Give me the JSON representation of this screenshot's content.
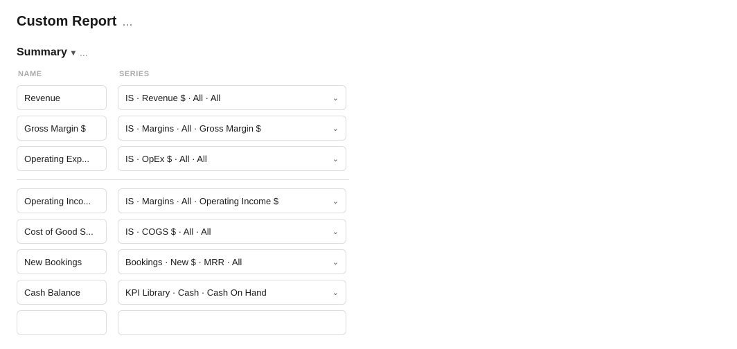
{
  "page": {
    "title": "Custom Report",
    "title_ellipsis": "..."
  },
  "section": {
    "label": "Summary",
    "chevron": "▾",
    "ellipsis": "..."
  },
  "columns": {
    "name": "NAME",
    "series": "SERIES"
  },
  "group1": [
    {
      "name": "Revenue",
      "series": "IS · Revenue $ · All · All"
    },
    {
      "name": "Gross Margin $",
      "series": "IS · Margins · All · Gross Margin $"
    },
    {
      "name": "Operating Exp...",
      "series": "IS · OpEx $ · All · All"
    }
  ],
  "group2": [
    {
      "name": "Operating Inco...",
      "series": "IS · Margins · All · Operating Income $"
    },
    {
      "name": "Cost of Good S...",
      "series": "IS · COGS $ · All · All"
    },
    {
      "name": "New Bookings",
      "series": "Bookings · New $ · MRR · All"
    },
    {
      "name": "Cash Balance",
      "series": "KPI Library · Cash · Cash On Hand"
    }
  ],
  "chevron_icon": "⌄"
}
